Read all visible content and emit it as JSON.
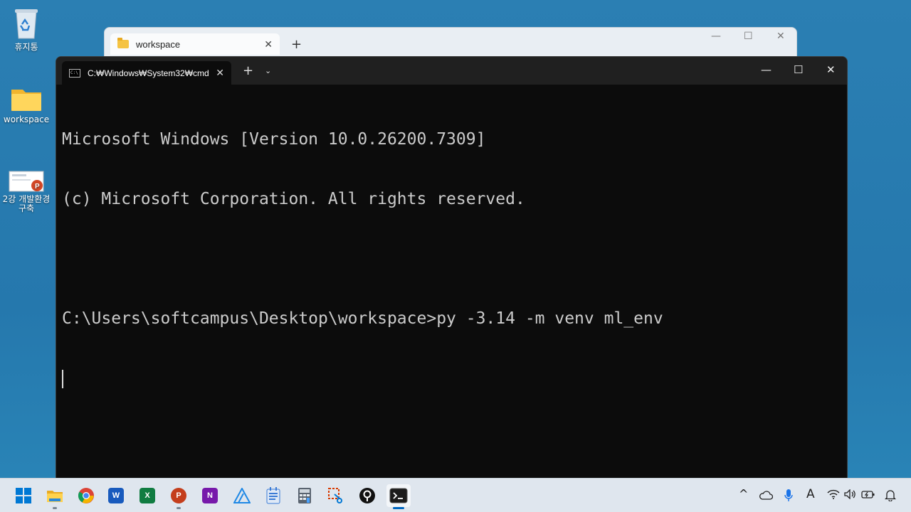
{
  "desktop": {
    "icons": [
      {
        "label": "휴지통"
      },
      {
        "label": "workspace"
      },
      {
        "label": "2강 개발환경 구축"
      }
    ]
  },
  "explorer": {
    "tab_title": "workspace",
    "close_glyph": "✕",
    "new_tab_glyph": "+",
    "minimize_glyph": "—",
    "maximize_glyph": "☐",
    "close_window_glyph": "✕"
  },
  "terminal": {
    "tab_title": "C:₩Windows₩System32₩cmd",
    "tab_icon_text": "C:\\",
    "close_tab_glyph": "✕",
    "new_tab_glyph": "+",
    "dropdown_glyph": "⌄",
    "minimize_glyph": "—",
    "maximize_glyph": "☐",
    "close_window_glyph": "✕",
    "lines": [
      "Microsoft Windows [Version 10.0.26200.7309]",
      "(c) Microsoft Corporation. All rights reserved.",
      "",
      "C:\\Users\\softcampus\\Desktop\\workspace>py -3.14 -m venv ml_env"
    ]
  },
  "taskbar": {
    "apps": [
      {
        "name": "start",
        "icon": "windows-logo-icon",
        "color": "#0078d4"
      },
      {
        "name": "file-explorer",
        "icon": "folder-icon",
        "color": "#f5c342"
      },
      {
        "name": "chrome",
        "icon": "chrome-icon",
        "color": "#db4437"
      },
      {
        "name": "word",
        "icon": "word-icon",
        "color": "#185abd",
        "letter": "W"
      },
      {
        "name": "excel",
        "icon": "excel-icon",
        "color": "#107c41",
        "letter": "X"
      },
      {
        "name": "powerpoint",
        "icon": "powerpoint-icon",
        "color": "#c43e1c",
        "letter": "P"
      },
      {
        "name": "onenote",
        "icon": "onenote-icon",
        "color": "#7719aa",
        "letter": "N"
      },
      {
        "name": "app-a",
        "icon": "triangle-app-icon",
        "color": "#1e88e5"
      },
      {
        "name": "notepad",
        "icon": "notepad-icon",
        "color": "#3a7bd5"
      },
      {
        "name": "calculator",
        "icon": "calculator-icon",
        "color": "#5a6470"
      },
      {
        "name": "snipping-tool",
        "icon": "snip-icon",
        "color": "#d83b01"
      },
      {
        "name": "app-pin",
        "icon": "pin-app-icon",
        "color": "#111111"
      },
      {
        "name": "terminal",
        "icon": "terminal-icon",
        "color": "#1b1b1b"
      }
    ],
    "tray": {
      "chevron": "^",
      "ime": "A"
    }
  }
}
